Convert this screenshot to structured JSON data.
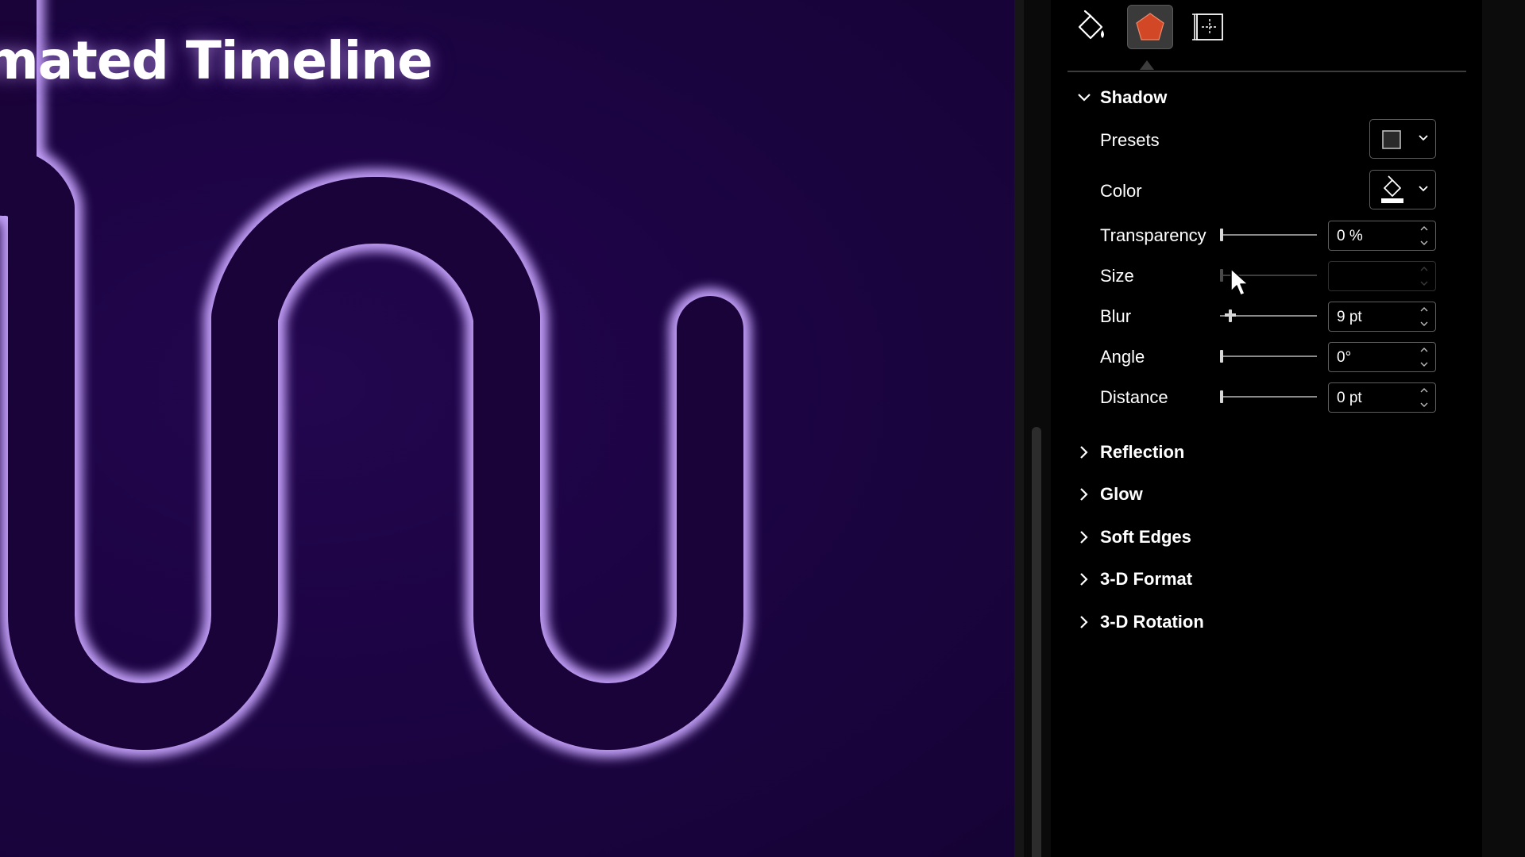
{
  "slide": {
    "title": "mated Timeline",
    "background_color": "#1c0443",
    "shape_color": "#1a0338",
    "glow_color": "#c9a6ff"
  },
  "pane": {
    "tabs": [
      {
        "icon": "fill-line-icon",
        "selected": false
      },
      {
        "icon": "effects-pentagon-icon",
        "selected": true
      },
      {
        "icon": "size-properties-icon",
        "selected": false
      }
    ],
    "accent_color": "#d24726",
    "shadow": {
      "label": "Shadow",
      "expanded": true,
      "presets_label": "Presets",
      "color_label": "Color",
      "properties": [
        {
          "label": "Transparency",
          "value": "0 %",
          "level": 0.0,
          "enabled": true
        },
        {
          "label": "Size",
          "value": "",
          "level": 0.0,
          "enabled": false
        },
        {
          "label": "Blur",
          "value": "9 pt",
          "level": 0.09,
          "enabled": true
        },
        {
          "label": "Angle",
          "value": "0°",
          "level": 0.0,
          "enabled": true
        },
        {
          "label": "Distance",
          "value": "0 pt",
          "level": 0.0,
          "enabled": true
        }
      ]
    },
    "sections": [
      {
        "label": "Reflection",
        "expanded": false
      },
      {
        "label": "Glow",
        "expanded": false
      },
      {
        "label": "Soft Edges",
        "expanded": false
      },
      {
        "label": "3-D Format",
        "expanded": false
      },
      {
        "label": "3-D Rotation",
        "expanded": false
      }
    ]
  }
}
